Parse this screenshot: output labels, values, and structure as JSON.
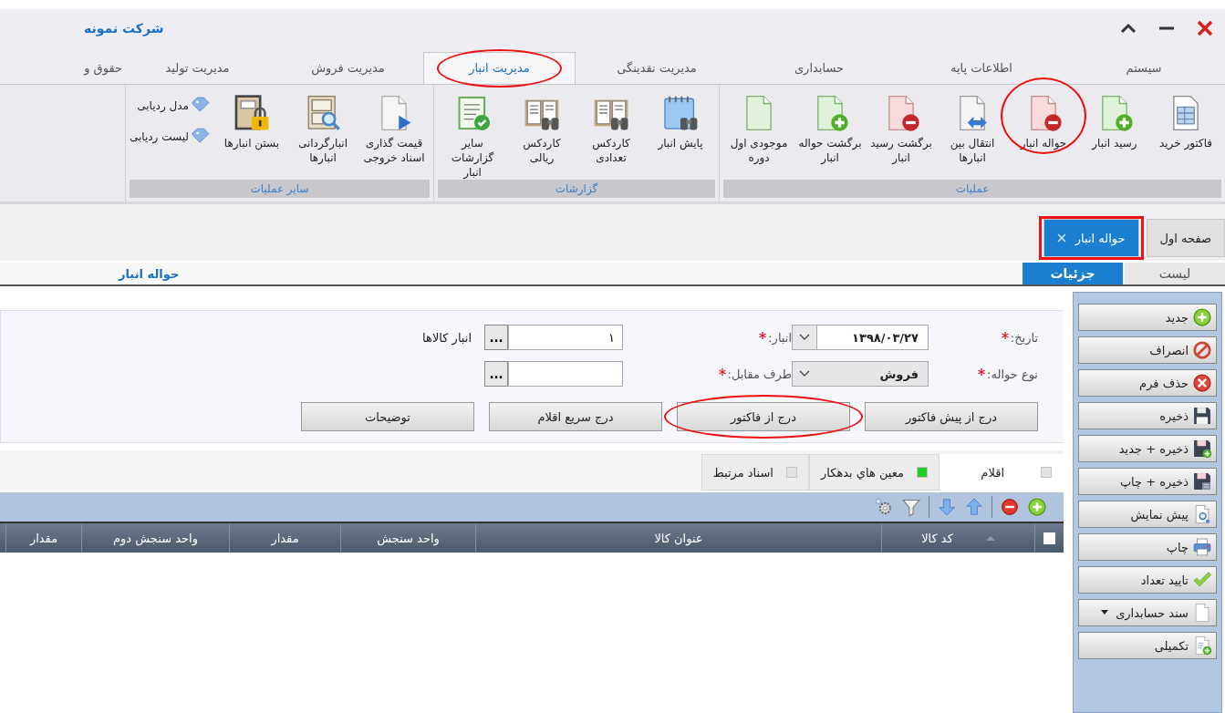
{
  "window": {
    "title": "شرکت نمونه"
  },
  "ribbon_tabs": [
    {
      "label": "سیستم",
      "selected": false,
      "circled": false
    },
    {
      "label": "اطلاعات پایه",
      "selected": false,
      "circled": false
    },
    {
      "label": "حسابداری",
      "selected": false,
      "circled": false
    },
    {
      "label": "مدیریت نقدینگی",
      "selected": false,
      "circled": false
    },
    {
      "label": "مدیریت انبار",
      "selected": true,
      "circled": true
    },
    {
      "label": "مدیریت فروش",
      "selected": false,
      "circled": false
    },
    {
      "label": "مدیریت تولید",
      "selected": false,
      "circled": false
    },
    {
      "label": "حقوق و",
      "selected": false,
      "circled": false
    }
  ],
  "ribbon_groups": [
    {
      "label": "عملیات",
      "buttons": [
        {
          "label": "فاکتور خرید",
          "circled": false
        },
        {
          "label": "رسید انبار",
          "circled": false
        },
        {
          "label": "حواله انبار",
          "circled": true
        },
        {
          "label": "انتقال بین انبارها",
          "circled": false
        },
        {
          "label": "برگشت رسید انبار",
          "circled": false
        },
        {
          "label": "برگشت حواله انبار",
          "circled": false
        },
        {
          "label": "موجودی اول دوره",
          "circled": false
        }
      ]
    },
    {
      "label": "گزارشات",
      "buttons": [
        {
          "label": "پایش انبار",
          "circled": false
        },
        {
          "label": "کاردکس تعدادی",
          "circled": false
        },
        {
          "label": "کاردکس ریالی",
          "circled": false
        },
        {
          "label": "سایر گزارشات انبار",
          "circled": false
        }
      ]
    },
    {
      "label": "سایر عملیات",
      "buttons": [
        {
          "label": "قیمت گذاری اسناد خروجی",
          "circled": false
        },
        {
          "label": "انبارگردانی انبارها",
          "circled": false
        },
        {
          "label": "بستن انبارها",
          "circled": false
        }
      ],
      "links": [
        "مدل ردیابی",
        "لیست ردیابی"
      ]
    }
  ],
  "document_tabs": [
    {
      "label": "صفحه اول",
      "selected": false,
      "boxed": false,
      "closable": false
    },
    {
      "label": "حواله انبار",
      "selected": true,
      "boxed": true,
      "closable": true
    }
  ],
  "view_tabs": [
    {
      "label": "لیست",
      "selected": false
    },
    {
      "label": "جزئیات",
      "selected": true
    }
  ],
  "page_title": "حواله انبار",
  "form": {
    "fields": [
      {
        "label": "تاریخ:",
        "required": true,
        "kind": "combo",
        "value": "۱۳۹۸/۰۳/۲۷"
      },
      {
        "label": "انبار:",
        "required": true,
        "kind": "lookup",
        "value": "۱",
        "lookup_button": "...",
        "note": "انبار کالاها"
      },
      {
        "label": "نوع حواله:",
        "required": true,
        "kind": "select",
        "value": "فروش"
      },
      {
        "label": "طرف مقابل:",
        "required": true,
        "kind": "lookup",
        "lookup_button": "..."
      }
    ],
    "buttons": [
      {
        "label": "درج از پیش فاکتور",
        "circled": false
      },
      {
        "label": "درج از فاکتور",
        "circled": true
      },
      {
        "label": "درج سریع اقلام",
        "circled": false
      },
      {
        "label": "توضیحات",
        "circled": false
      }
    ]
  },
  "detail_tabs": [
    {
      "label": "اقلام",
      "selected": true,
      "color": "#e2e2e2"
    },
    {
      "label": "معین هاي بدهکار",
      "selected": false,
      "color": "#22cc22"
    },
    {
      "label": "اسناد مرتبط",
      "selected": false,
      "color": "#e2e2e2"
    }
  ],
  "grid": {
    "select_all": {
      "checked": false
    },
    "columns": [
      "کد کالا",
      "عنوان کالا",
      "واحد سنجش",
      "مقدار",
      "واحد سنجش دوم",
      "مقدار"
    ]
  },
  "sidebar_buttons": [
    {
      "label": "جدید",
      "dropdown": false
    },
    {
      "label": "انصراف",
      "dropdown": false
    },
    {
      "label": "حذف فرم",
      "dropdown": false
    },
    {
      "label": "ذخیره",
      "dropdown": false
    },
    {
      "label": "ذخیره + جدید",
      "dropdown": false
    },
    {
      "label": "ذخیره + چاپ",
      "dropdown": false
    },
    {
      "label": "پیش نمایش",
      "dropdown": false
    },
    {
      "label": "چاپ",
      "dropdown": false
    },
    {
      "label": "تایید تعداد",
      "dropdown": false
    },
    {
      "label": "سند حسابداری",
      "dropdown": true
    },
    {
      "label": "تکمیلی",
      "dropdown": false
    }
  ]
}
